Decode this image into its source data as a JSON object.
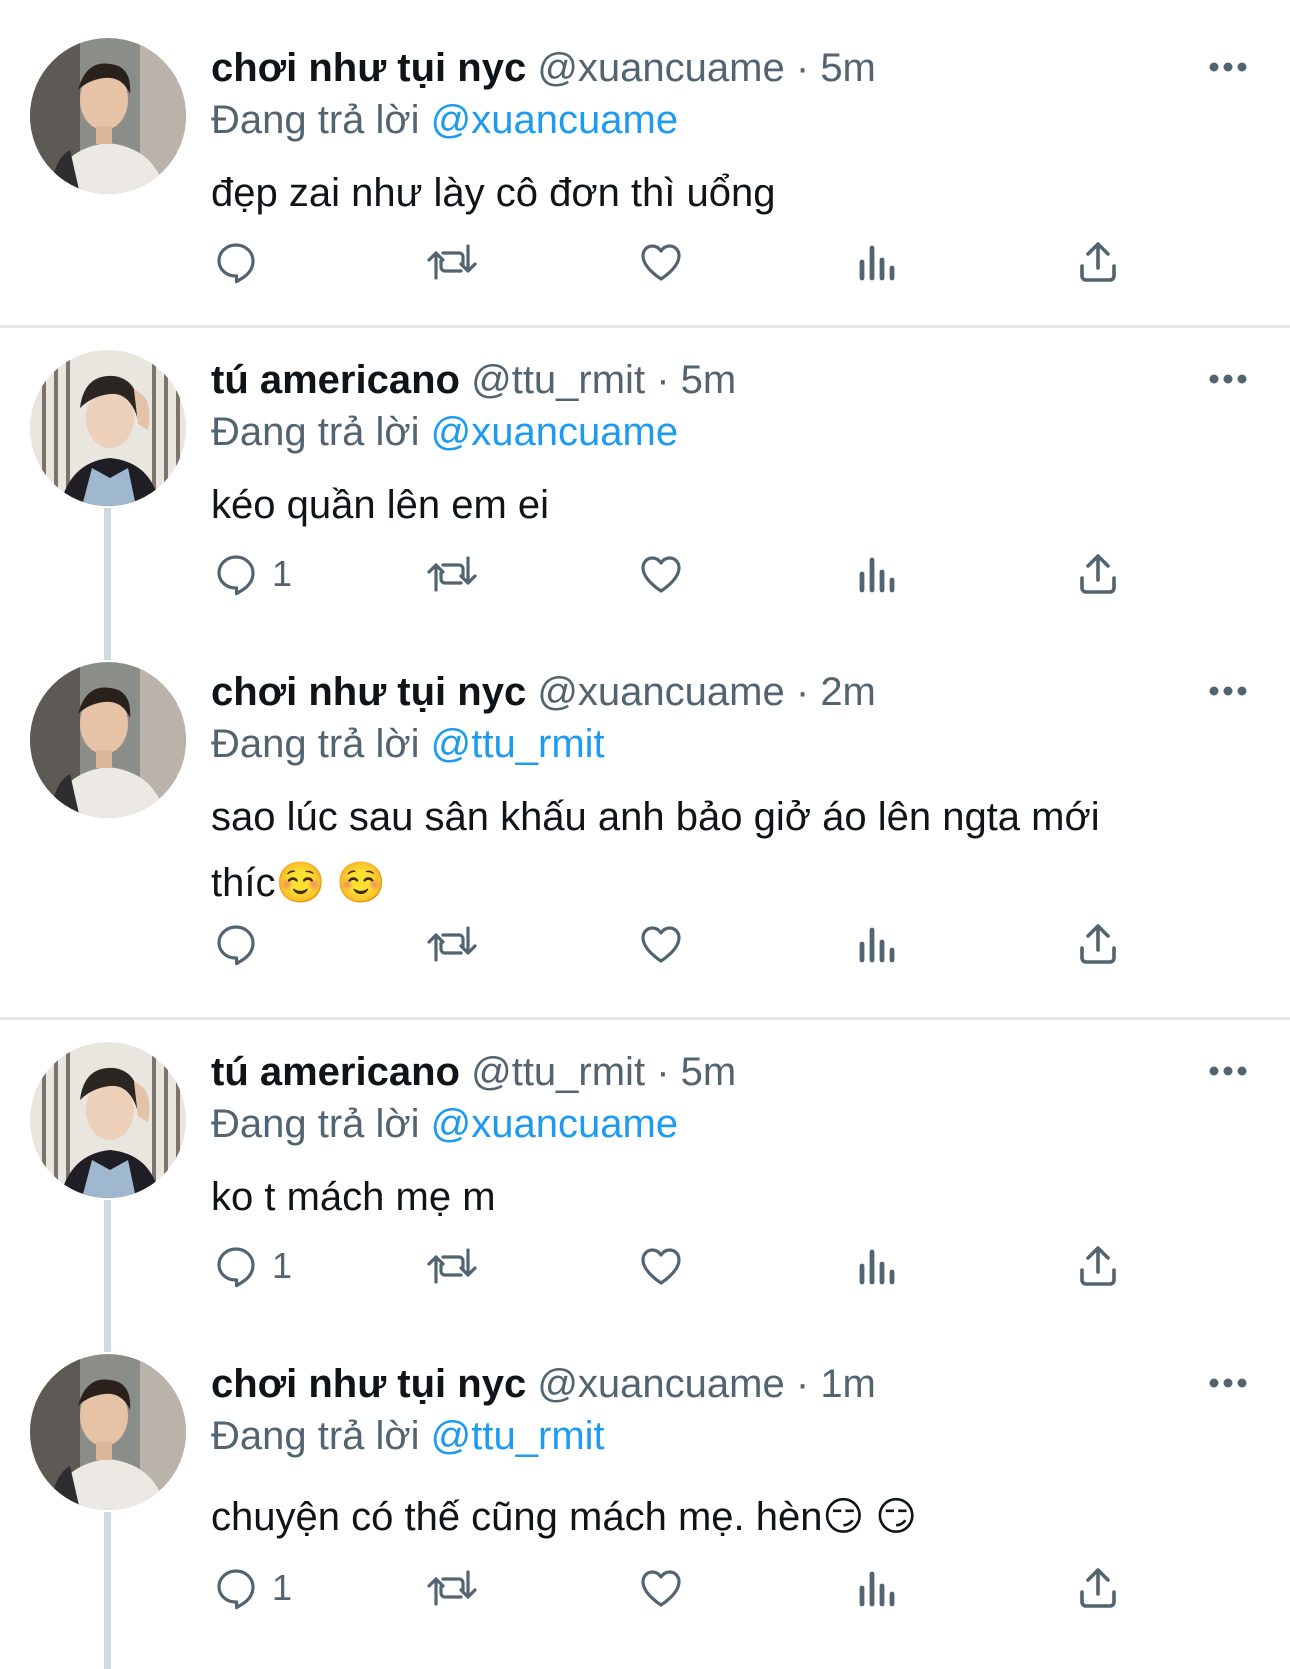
{
  "tweets": [
    {
      "name": "chơi như tụi nyc",
      "handle": "@xuancuame",
      "time": "5m",
      "reply_prefix": "Đang trả lời",
      "reply_to": "@xuancuame",
      "text_lines": [
        "đẹp zai như lày cô đơn thì uổng"
      ],
      "reply_count": ""
    },
    {
      "name": "tú americano",
      "handle": "@ttu_rmit",
      "time": "5m",
      "reply_prefix": "Đang trả lời",
      "reply_to": "@xuancuame",
      "text_lines": [
        "kéo quần lên em ei"
      ],
      "reply_count": "1"
    },
    {
      "name": "chơi như tụi nyc",
      "handle": "@xuancuame",
      "time": "2m",
      "reply_prefix": "Đang trả lời",
      "reply_to": "@ttu_rmit",
      "text_lines": [
        "sao lúc sau sân khấu anh bảo giở áo lên ngta mới",
        "thíc☺️ ☺️"
      ],
      "reply_count": ""
    },
    {
      "name": "tú americano",
      "handle": "@ttu_rmit",
      "time": "5m",
      "reply_prefix": "Đang trả lời",
      "reply_to": "@xuancuame",
      "text_lines": [
        "ko t mách mẹ m"
      ],
      "reply_count": "1"
    },
    {
      "name": "chơi như tụi nyc",
      "handle": "@xuancuame",
      "time": "1m",
      "reply_prefix": "Đang trả lời",
      "reply_to": "@ttu_rmit",
      "text_lines": [
        "chuyện có thế cũng mách mẹ. hèn😏 😏"
      ],
      "reply_count": "1"
    }
  ],
  "icons": {
    "reply": "reply-icon",
    "retweet": "retweet-icon",
    "like": "like-icon",
    "views": "views-icon",
    "share": "share-icon",
    "more": "more-icon"
  },
  "colors": {
    "text": "#0f1419",
    "secondary": "#536471",
    "mention": "#1d9bf0",
    "divider": "#e3e7ea",
    "thread_line": "#cfd9de"
  }
}
